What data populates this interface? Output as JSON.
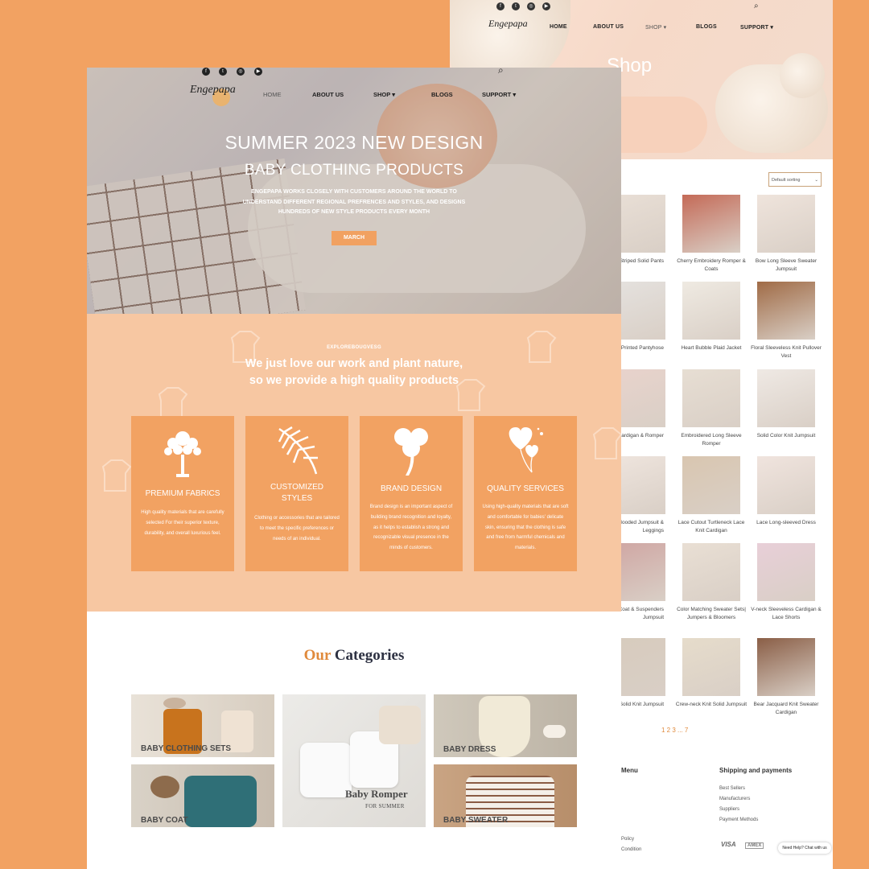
{
  "colors": {
    "background": "#f2a262",
    "accent": "#f2a262",
    "feature_bg": "#f7c7a2",
    "cat_title_accent": "#e08a3c",
    "cat_title_main": "#2d3142"
  },
  "back_page": {
    "nav": {
      "home": "HOME",
      "about": "ABOUT US",
      "shop": "SHOP",
      "blogs": "BLOGS",
      "support": "SUPPORT"
    },
    "hero_title": "Shop",
    "sort_select": "Default sorting",
    "products": [
      "Striped Solid Pants",
      "Cherry Embroidery Romper & Coats",
      "Bow Long Sleeve Sweater Jumpsuit",
      "Printed Pantyhose",
      "Heart Bubble Plaid Jacket",
      "Floral Sleeveless Knit Pullover Vest",
      "Suit Cardigan & Romper",
      "Embroidered Long Sleeve Romper",
      "Solid Color Knit Jumpsuit",
      "Bear Ears Hooded Jumpsuit & Leggings",
      "Lace Cutout Turtleneck Lace Knit Cardigan",
      "Lace Long-sleeved Dress",
      "Ruffled Knit Coat & Suspenders Jumpsuit",
      "Color Matching Sweater Sets| Jumpers & Bloomers",
      "V-neck Sleeveless Cardigan & Lace Shorts",
      "Solid Knit Jumpsuit",
      "Crew-neck Knit Solid Jumpsuit",
      "Bear Jacquard Knit Sweater Cardigan"
    ],
    "pagination": "1 2 3 ... 7",
    "footer": {
      "menu_title": "Menu",
      "shipping_title": "Shipping and payments",
      "shipping_links": [
        "Best Sellers",
        "Manufacturers",
        "Suppliers",
        "Payment Methods"
      ],
      "policy_links": [
        "Policy",
        "Condition"
      ],
      "payment_badges": [
        "VISA",
        "AMEX"
      ]
    },
    "chat": "Need Help? Chat with us"
  },
  "front_page": {
    "nav": {
      "home": "HOME",
      "about": "ABOUT US",
      "shop": "SHOP",
      "blogs": "BLOGS",
      "support": "SUPPORT"
    },
    "logo": "Engepapa",
    "hero": {
      "title": "SUMMER 2023 NEW DESIGN",
      "subtitle": "BABY CLOTHING PRODUCTS",
      "desc": "ENGEPAPA WORKS CLOSELY WITH CUSTOMERS AROUND THE WORLD TO UNDERSTAND DIFFERENT REGIONAL PREFRENCES AND STYLES, AND DESIGNS HUNDREDS OF NEW STYLE PRODUCTS EVERY MONTH",
      "button": "MARCH"
    },
    "features": {
      "kicker": "EXPLOREBOUGVESG",
      "heading_line1": "We just love our work and plant nature,",
      "heading_line2": "so we provide a high quality products",
      "cards": [
        {
          "title": "PREMIUM FABRICS",
          "desc": "High quality materials that are carefully selected For their superior texture, durability, and overall luxurious feel.",
          "icon": "tree-icon"
        },
        {
          "title": "CUSTOMIZED STYLES",
          "desc": "Clothing or accessories that are tailored to meet the specific preferences or needs of an individual.",
          "icon": "leaf-icon"
        },
        {
          "title": "BRAND DESIGN",
          "desc": "Brand design is an important aspect of building brand recognition and loyalty, as it helps to establish a strong and recognizable visual presence in the minds of customers.",
          "icon": "clover-icon"
        },
        {
          "title": "QUALITY SERVICES",
          "desc": "Using high-quality materials that are soft and comfortable for babies' delicate skin, ensuring that the clothing is safe and free from harmful chemicals and materials.",
          "icon": "hearts-icon"
        }
      ]
    },
    "categories": {
      "title_accent": "Our",
      "title_main": "Categories",
      "tiles": [
        {
          "label": "BABY CLOTHING SETS"
        },
        {
          "label": "Baby Romper",
          "sub": "FOR SUMMER"
        },
        {
          "label": "BABY DRESS"
        },
        {
          "label": "BABY COAT"
        },
        {
          "label": "BABY SWEATER"
        }
      ]
    }
  }
}
